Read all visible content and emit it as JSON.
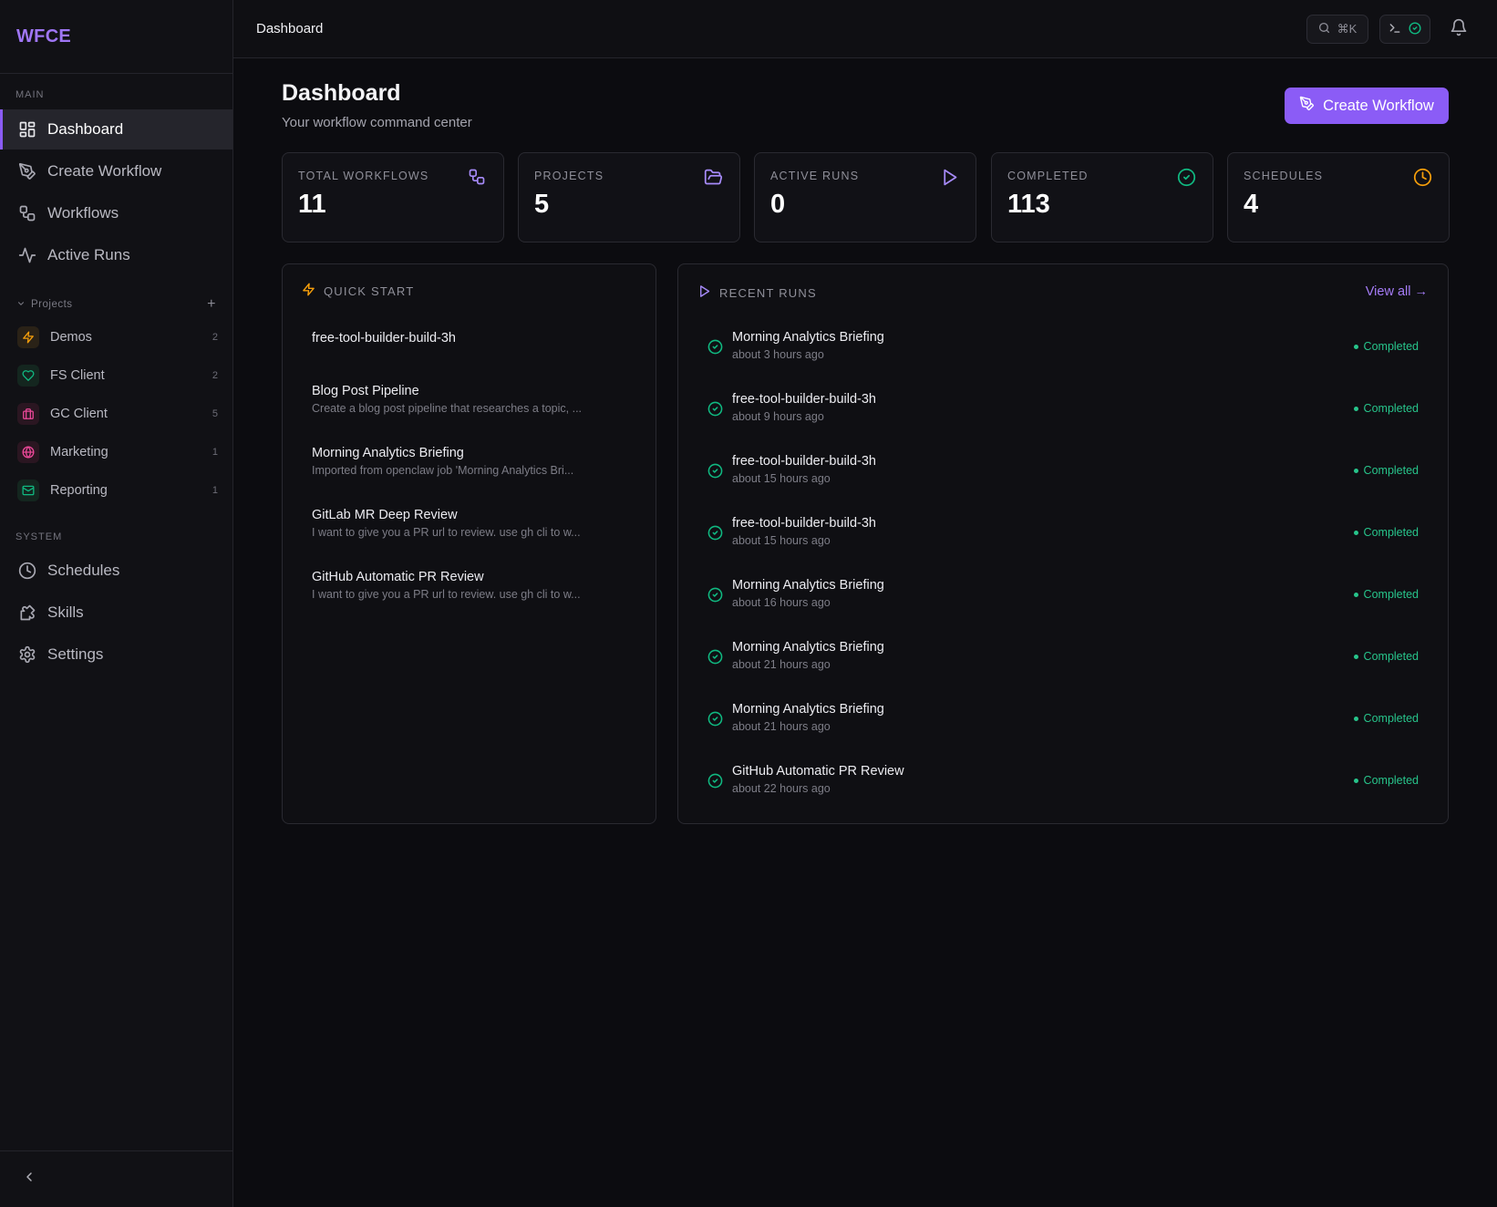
{
  "app": {
    "brand": "WFCE"
  },
  "sidebar": {
    "main_label": "MAIN",
    "main_items": [
      {
        "label": "Dashboard",
        "icon": "dashboard-icon",
        "active": true
      },
      {
        "label": "Create Workflow",
        "icon": "pen-tool-icon"
      },
      {
        "label": "Workflows",
        "icon": "workflow-icon"
      },
      {
        "label": "Active Runs",
        "icon": "activity-icon"
      }
    ],
    "projects_label": "Projects",
    "projects": [
      {
        "label": "Demos",
        "count": "2",
        "icon": "zap-icon",
        "color": "#f59e0b"
      },
      {
        "label": "FS Client",
        "count": "2",
        "icon": "heart-icon",
        "color": "#10b981"
      },
      {
        "label": "GC Client",
        "count": "5",
        "icon": "briefcase-icon",
        "color": "#ec4899"
      },
      {
        "label": "Marketing",
        "count": "1",
        "icon": "globe-icon",
        "color": "#ec4899"
      },
      {
        "label": "Reporting",
        "count": "1",
        "icon": "mail-icon",
        "color": "#10b981"
      }
    ],
    "system_label": "SYSTEM",
    "system_items": [
      {
        "label": "Schedules",
        "icon": "clock-icon"
      },
      {
        "label": "Skills",
        "icon": "puzzle-icon"
      },
      {
        "label": "Settings",
        "icon": "gear-icon"
      }
    ]
  },
  "topbar": {
    "breadcrumb": "Dashboard",
    "search_shortcut": "⌘K"
  },
  "main": {
    "title": "Dashboard",
    "subtitle": "Your workflow command center",
    "create_label": "Create Workflow"
  },
  "stats": [
    {
      "label": "TOTAL WORKFLOWS",
      "value": "11",
      "icon": "workflow-icon",
      "color": "#a78bfa"
    },
    {
      "label": "PROJECTS",
      "value": "5",
      "icon": "folder-open-icon",
      "color": "#a78bfa"
    },
    {
      "label": "ACTIVE RUNS",
      "value": "0",
      "icon": "play-icon",
      "color": "#a78bfa"
    },
    {
      "label": "COMPLETED",
      "value": "113",
      "icon": "check-circle-icon",
      "color": "#10b981"
    },
    {
      "label": "SCHEDULES",
      "value": "4",
      "icon": "clock-icon",
      "color": "#f59e0b"
    }
  ],
  "quick_start": {
    "title": "QUICK START",
    "items": [
      {
        "title": "free-tool-builder-build-3h",
        "desc": ""
      },
      {
        "title": "Blog Post Pipeline",
        "desc": "Create a blog post pipeline that researches a topic, ..."
      },
      {
        "title": "Morning Analytics Briefing",
        "desc": "Imported from openclaw job 'Morning Analytics Bri..."
      },
      {
        "title": "GitLab MR Deep Review",
        "desc": "I want to give you a PR url to review. use gh cli to w..."
      },
      {
        "title": "GitHub Automatic PR Review",
        "desc": "I want to give you a PR url to review. use gh cli to w..."
      }
    ]
  },
  "recent_runs": {
    "title": "RECENT RUNS",
    "view_all": "View all →",
    "runs": [
      {
        "name": "Morning Analytics Briefing",
        "time": "about 3 hours ago",
        "status": "Completed"
      },
      {
        "name": "free-tool-builder-build-3h",
        "time": "about 9 hours ago",
        "status": "Completed"
      },
      {
        "name": "free-tool-builder-build-3h",
        "time": "about 15 hours ago",
        "status": "Completed"
      },
      {
        "name": "free-tool-builder-build-3h",
        "time": "about 15 hours ago",
        "status": "Completed"
      },
      {
        "name": "Morning Analytics Briefing",
        "time": "about 16 hours ago",
        "status": "Completed"
      },
      {
        "name": "Morning Analytics Briefing",
        "time": "about 21 hours ago",
        "status": "Completed"
      },
      {
        "name": "Morning Analytics Briefing",
        "time": "about 21 hours ago",
        "status": "Completed"
      },
      {
        "name": "GitHub Automatic PR Review",
        "time": "about 22 hours ago",
        "status": "Completed"
      }
    ]
  }
}
